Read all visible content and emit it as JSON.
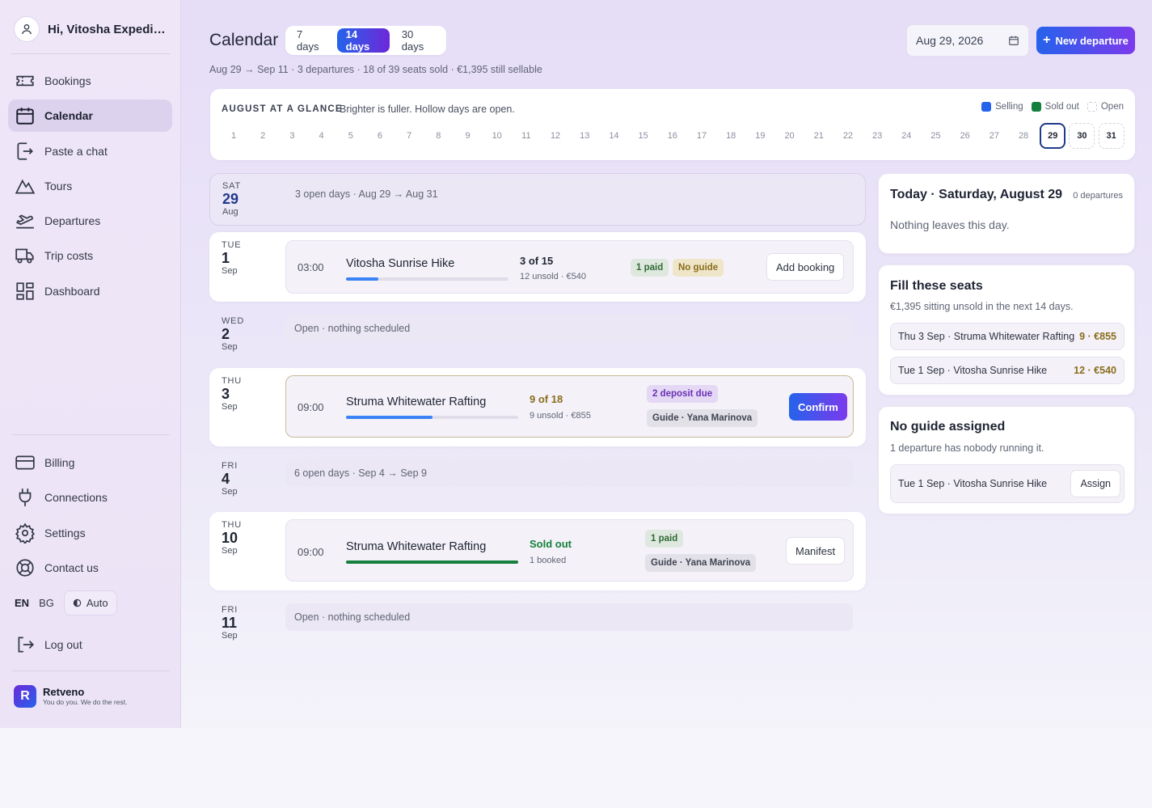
{
  "user": {
    "greeting": "Hi, Vitosha Expediti..."
  },
  "nav": [
    {
      "label": "Bookings",
      "icon": "ticket-icon",
      "active": false
    },
    {
      "label": "Calendar",
      "icon": "calendar-icon",
      "active": true
    },
    {
      "label": "Paste a chat",
      "icon": "paste-icon",
      "active": false
    },
    {
      "label": "Tours",
      "icon": "mountain-icon",
      "active": false
    },
    {
      "label": "Departures",
      "icon": "plane-departure-icon",
      "active": false
    },
    {
      "label": "Trip costs",
      "icon": "truck-icon",
      "active": false
    },
    {
      "label": "Dashboard",
      "icon": "dashboard-icon",
      "active": false
    }
  ],
  "nav_bottom": [
    {
      "label": "Billing",
      "icon": "credit-card-icon"
    },
    {
      "label": "Connections",
      "icon": "plug-icon"
    },
    {
      "label": "Settings",
      "icon": "gear-icon"
    },
    {
      "label": "Contact us",
      "icon": "lifebuoy-icon"
    }
  ],
  "lang": {
    "en": "EN",
    "bg": "BG",
    "auto": "Auto"
  },
  "logout": "Log out",
  "brand": {
    "name": "Retveno",
    "tagline": "You do you. We do the rest.",
    "logo_letter": "R"
  },
  "header": {
    "title": "Calendar",
    "ranges": [
      "7 days",
      "14 days",
      "30 days"
    ],
    "active_range": "14 days",
    "subtitle": "Aug 29 → Sep 11 · 3 departures · 18 of 39 seats sold · €1,395 still sellable",
    "date": "Aug 29, 2026",
    "new_button": "New departure"
  },
  "glance": {
    "title": "AUGUST AT A GLANCE",
    "desc": "Brighter is fuller. Hollow days are open.",
    "legend": [
      "Selling",
      "Sold out",
      "Open"
    ],
    "days": [
      "1",
      "2",
      "3",
      "4",
      "5",
      "6",
      "7",
      "8",
      "9",
      "10",
      "11",
      "12",
      "13",
      "14",
      "15",
      "16",
      "17",
      "18",
      "19",
      "20",
      "21",
      "22",
      "23",
      "24",
      "25",
      "26",
      "27",
      "28",
      "29",
      "30",
      "31"
    ],
    "today": "29"
  },
  "rows": {
    "sat29": {
      "dow": "SAT",
      "num": "29",
      "mon": "Aug",
      "text": "3 open days · Aug 29 → Aug 31"
    },
    "tue1": {
      "dow": "TUE",
      "num": "1",
      "mon": "Sep",
      "time": "03:00",
      "name": "Vitosha Sunrise Hike",
      "seats": "3 of 15",
      "seat_sub": "12 unsold · €540",
      "fill": 0.2,
      "badges": [
        "1 paid",
        "No guide"
      ],
      "action": "Add booking"
    },
    "wed2": {
      "dow": "WED",
      "num": "2",
      "mon": "Sep",
      "text": "Open · nothing scheduled"
    },
    "thu3": {
      "dow": "THU",
      "num": "3",
      "mon": "Sep",
      "time": "09:00",
      "name": "Struma Whitewater Rafting",
      "seats": "9 of 18",
      "seat_sub": "9 unsold · €855",
      "fill": 0.5,
      "badges": [
        "2 deposit due",
        "Guide · Yana Marinova"
      ],
      "action": "Confirm"
    },
    "fri4": {
      "dow": "FRI",
      "num": "4",
      "mon": "Sep",
      "text": "6 open days · Sep 4 → Sep 9"
    },
    "thu10": {
      "dow": "THU",
      "num": "10",
      "mon": "Sep",
      "time": "09:00",
      "name": "Struma Whitewater Rafting",
      "seats": "Sold out",
      "seat_sub": "1 booked",
      "fill": 1.0,
      "badges": [
        "1 paid",
        "Guide · Yana Marinova"
      ],
      "action": "Manifest"
    },
    "fri11": {
      "dow": "FRI",
      "num": "11",
      "mon": "Sep",
      "text": "Open · nothing scheduled"
    }
  },
  "today_panel": {
    "title": "Today · Saturday, August 29",
    "meta": "0 departures",
    "text": "Nothing leaves this day."
  },
  "fill_panel": {
    "title": "Fill these seats",
    "text": "€1,395 sitting unsold in the next 14 days.",
    "items": [
      {
        "label": "Thu 3 Sep · Struma Whitewater Rafting",
        "amount": "9 · €855"
      },
      {
        "label": "Tue 1 Sep · Vitosha Sunrise Hike",
        "amount": "12 · €540"
      }
    ]
  },
  "guide_panel": {
    "title": "No guide assigned",
    "text": "1 departure has nobody running it.",
    "item": "Tue 1 Sep · Vitosha Sunrise Hike",
    "action": "Assign"
  },
  "colors": {
    "accent": "#2563eb",
    "accent2": "#7c3aed",
    "sold_out": "#15803d",
    "amber": "#8a6d1d"
  }
}
